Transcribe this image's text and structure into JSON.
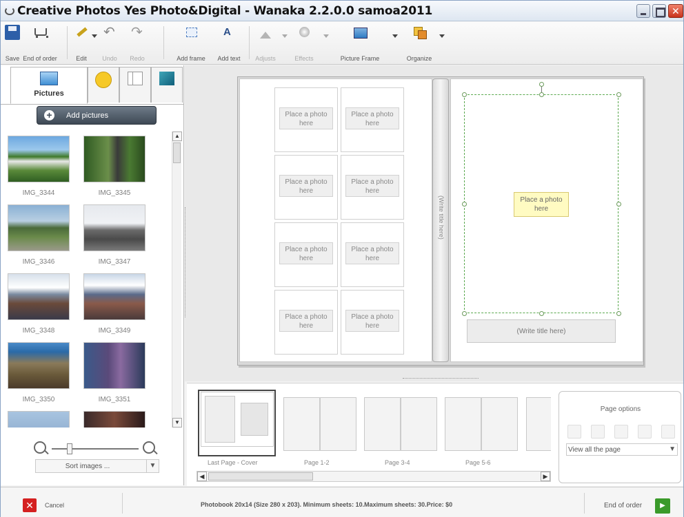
{
  "window": {
    "title": "Creative Photos Yes Photo&Digital - Wanaka 2.2.0.0 samoa2011"
  },
  "toolbar": {
    "save": "Save",
    "end_of_order": "End of order",
    "edit": "Edit",
    "undo": "Undo",
    "redo": "Redo",
    "add_frame": "Add frame",
    "add_text": "Add text",
    "adjust": "Adjusts",
    "effects": "Effects",
    "picture_frame": "Picture Frame",
    "organize": "Organize"
  },
  "left_panel": {
    "tab_pictures": "Pictures",
    "add_pictures": "Add pictures",
    "thumbnails": [
      "IMG_3344",
      "IMG_3345",
      "IMG_3346",
      "IMG_3347",
      "IMG_3348",
      "IMG_3349",
      "IMG_3350",
      "IMG_3351"
    ],
    "sort_label": "Sort images ..."
  },
  "album": {
    "placeholder": "Place a photo here",
    "spine_title": "(Write title here)",
    "title_placeholder": "(Write title here)"
  },
  "filmstrip": {
    "pages": [
      "Last Page - Cover",
      "Page 1-2",
      "Page 3-4",
      "Page 5-6"
    ]
  },
  "page_options": {
    "title": "Page options",
    "select_value": "View all the page"
  },
  "status": {
    "cancel": "Cancel",
    "info": "Photobook 20x14 (Size 280 x 203). Minimum sheets: 10.Maximum sheets: 30.Price: $0",
    "end_of_order": "End of order"
  },
  "colors": {
    "accent": "#2d5fa8",
    "selection": "#5aa84e",
    "cancel": "#d42020",
    "go": "#3a9a2a"
  }
}
